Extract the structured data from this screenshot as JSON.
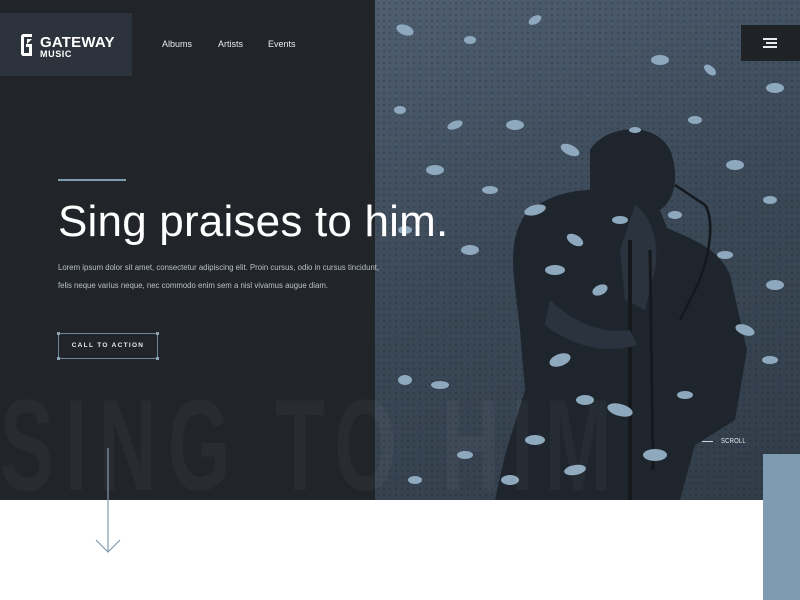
{
  "brand": {
    "name": "GATEWAY",
    "sub": "MUSIC"
  },
  "nav": {
    "items": [
      {
        "label": "Albums"
      },
      {
        "label": "Artists"
      },
      {
        "label": "Events"
      }
    ]
  },
  "hero": {
    "headline": "Sing praises to him.",
    "body": "Lorem ipsum dolor sit amet, consectetur adipiscing elit. Proin cursus, odio in cursus tincidunt, felis neque varius neque, nec commodo enim sem a nisl vivamus augue diam.",
    "cta_label": "CALL TO ACTION",
    "watermark": "SING TO HIM",
    "scroll_label": "SCROLL"
  },
  "icons": {
    "logo": "gateway-g-icon",
    "menu": "hamburger-menu-icon",
    "scroll": "arrow-down-icon"
  },
  "colors": {
    "hero_bg": "#212428",
    "logo_bg": "#2c333c",
    "accent": "#7f9bb1",
    "photo_tint": "#4f5f70",
    "text_light": "#e8ecef"
  }
}
